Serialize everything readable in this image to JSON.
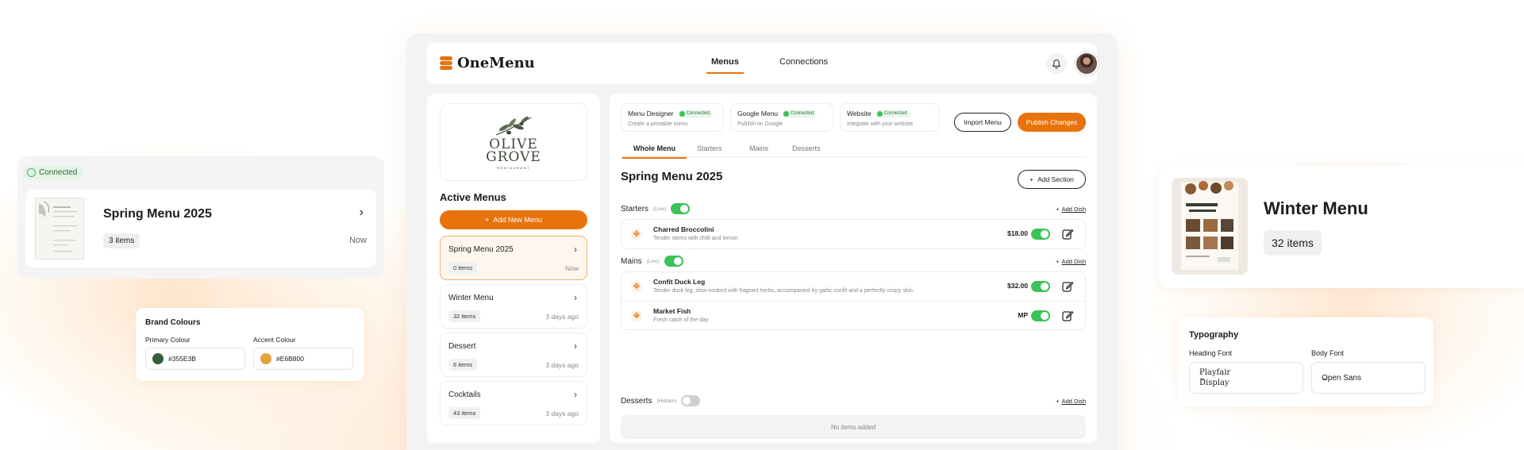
{
  "app": {
    "brand": "OneMenu",
    "nav": [
      "Menus",
      "Connections"
    ],
    "accent": "#E8730D",
    "success": "#3CC256"
  },
  "sidebar": {
    "restaurant_logo": [
      "OLIVE",
      "GROVE",
      "RESTAURANT"
    ],
    "active_menus_title": "Active Menus",
    "add_menu_label": "Add New Menu",
    "menus": [
      {
        "name": "Spring Menu 2025",
        "count": "0 items",
        "time": "Now"
      },
      {
        "name": "Winter Menu",
        "count": "32 items",
        "time": "3 days ago"
      },
      {
        "name": "Dessert",
        "count": "6 items",
        "time": "3 days ago"
      },
      {
        "name": "Cocktails",
        "count": "43 items",
        "time": "3 days ago"
      }
    ]
  },
  "connections": [
    {
      "title": "Menu Designer",
      "badge": "Connected",
      "subtitle": "Create a printable menu"
    },
    {
      "title": "Google Menu",
      "badge": "Connected",
      "subtitle": "Publish on Google"
    },
    {
      "title": "Website",
      "badge": "Connected",
      "subtitle": "Integrate with your website"
    }
  ],
  "actions": {
    "import": "Import Menu",
    "publish": "Publish Changes",
    "add_section": "Add Section",
    "add_dish": "Add Dish"
  },
  "tabs": [
    "Whole Menu",
    "Starters",
    "Mains",
    "Desserts"
  ],
  "menu": {
    "title": "Spring Menu 2025",
    "sections": [
      {
        "name": "Starters",
        "tag": "(Live)",
        "live": true,
        "dishes": [
          {
            "name": "Charred Broccolini",
            "desc": "Tender stems with chilli and lemon",
            "price": "$18.00"
          }
        ]
      },
      {
        "name": "Mains",
        "tag": "(Live)",
        "live": true,
        "dishes": [
          {
            "name": "Confit Duck Leg",
            "desc": "Tender duck leg, slow-cooked with fragrant herbs, accompanied by garlic confit and a perfectly crispy skin.",
            "price": "$32.00"
          },
          {
            "name": "Market Fish",
            "desc": "Fresh catch of the day",
            "price": "MP"
          }
        ]
      },
      {
        "name": "Desserts",
        "tag": "(Hidden)",
        "live": false,
        "empty": "No items added"
      }
    ]
  },
  "float_card": {
    "badge": "Connected",
    "name": "Spring Menu 2025",
    "count": "3 items",
    "time": "Now"
  },
  "brand_colours": {
    "title": "Brand Colours",
    "primary_label": "Primary Colour",
    "primary": "#355E3B",
    "accent_label": "Accent Colour",
    "accent": "#E6B800"
  },
  "winter_card": {
    "name": "Winter Menu",
    "count": "32 items"
  },
  "typography": {
    "title": "Typography",
    "heading_label": "Heading Font",
    "heading_value": "Playfair Display",
    "body_label": "Body Font",
    "body_value": "Open Sans"
  }
}
